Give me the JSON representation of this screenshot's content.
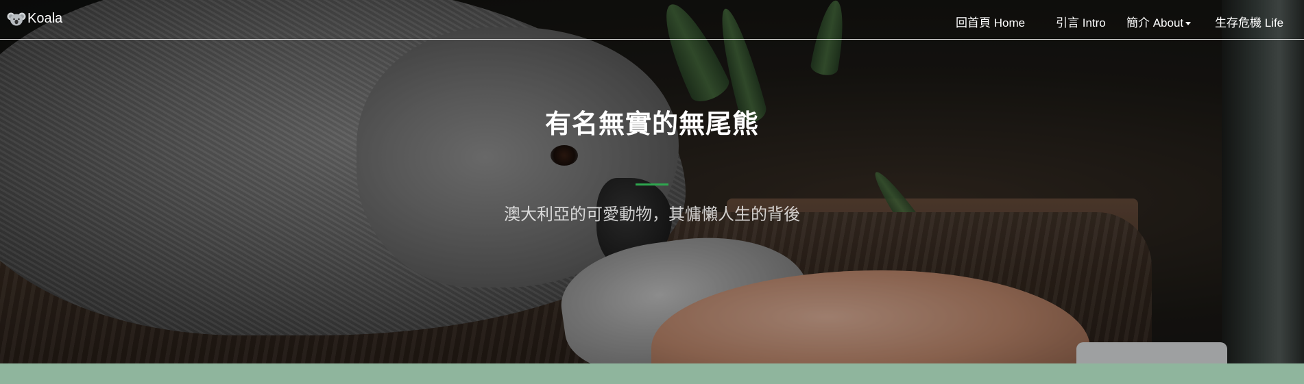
{
  "navbar": {
    "brand": {
      "icon": "koala-icon",
      "label": "Koala"
    },
    "items": [
      {
        "label": "回首頁 Home"
      },
      {
        "label": "引言 Intro"
      },
      {
        "label": "簡介 About",
        "has_dropdown": true
      },
      {
        "label": "生存危機 Life"
      }
    ]
  },
  "hero": {
    "title": "有名無實的無尾熊",
    "subtitle": "澳大利亞的可愛動物，其慵懶人生的背後",
    "divider_color": "#2ea84f"
  },
  "colors": {
    "footer_strip": "#8fb59d",
    "text": "#ffffff"
  }
}
